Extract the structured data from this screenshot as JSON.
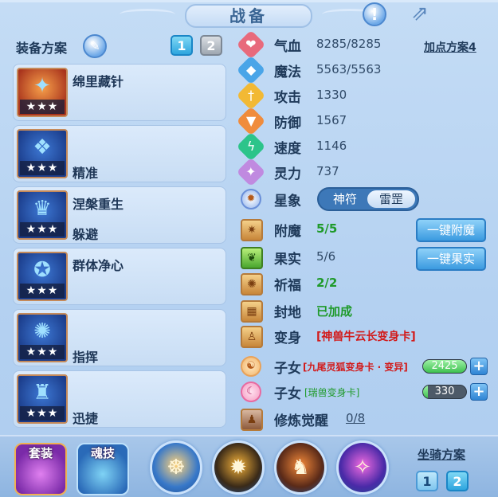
{
  "header": {
    "title": "战备"
  },
  "left": {
    "section_label": "装备方案",
    "pages": [
      "1",
      "2"
    ],
    "cards": [
      {
        "line1": "绵里藏针",
        "line2": "",
        "stars": "★★★",
        "glyph": "✦"
      },
      {
        "line1": "",
        "line2": "精准",
        "stars": "★★★",
        "glyph": "❖"
      },
      {
        "line1": "涅槃重生",
        "line2": "躲避",
        "stars": "★★★",
        "glyph": "♛"
      },
      {
        "line1": "群体净心",
        "line2": "",
        "stars": "★★★",
        "glyph": "✪"
      },
      {
        "line1": "",
        "line2": "指挥",
        "stars": "★★★",
        "glyph": "✺"
      },
      {
        "line1": "",
        "line2": "迅捷",
        "stars": "★★★",
        "glyph": "♜"
      }
    ]
  },
  "stats": {
    "plan_link": "加点方案4",
    "hp_label": "气血",
    "hp_value": "8285/8285",
    "mp_label": "魔法",
    "mp_value": "5563/5563",
    "atk_label": "攻击",
    "atk_value": "1330",
    "def_label": "防御",
    "def_value": "1567",
    "spd_label": "速度",
    "spd_value": "1146",
    "spirit_label": "灵力",
    "spirit_value": "737",
    "star_label": "星象",
    "star_options": [
      "神符",
      "雷罡"
    ]
  },
  "extras": {
    "enchant_label": "附魔",
    "enchant_value": "5/5",
    "enchant_btn": "一键附魔",
    "fruit_label": "果实",
    "fruit_value": "5/6",
    "fruit_btn": "一键果实",
    "bless_label": "祈福",
    "bless_value": "2/2",
    "seal_label": "封地",
    "seal_value": "已加成",
    "transform_label": "变身",
    "transform_value": "[神兽牛云长变身卡]",
    "child1_label": "子女",
    "child1_value": "[九尾灵狐变身卡 · 变异]",
    "child1_bar": "2425",
    "child2_label": "子女",
    "child2_value": "[瑞兽变身卡]",
    "child2_bar": "330",
    "awaken_label": "修炼觉醒",
    "awaken_value": "0/8"
  },
  "bottom": {
    "suit_label": "套装",
    "soul_label": "魂技",
    "mount_label": "坐骑方案",
    "mount_pages": [
      "1",
      "2"
    ]
  },
  "colors": {
    "accent_blue": "#3b9ae0",
    "green_text": "#1f9a2a",
    "red_text": "#d21b1b"
  }
}
